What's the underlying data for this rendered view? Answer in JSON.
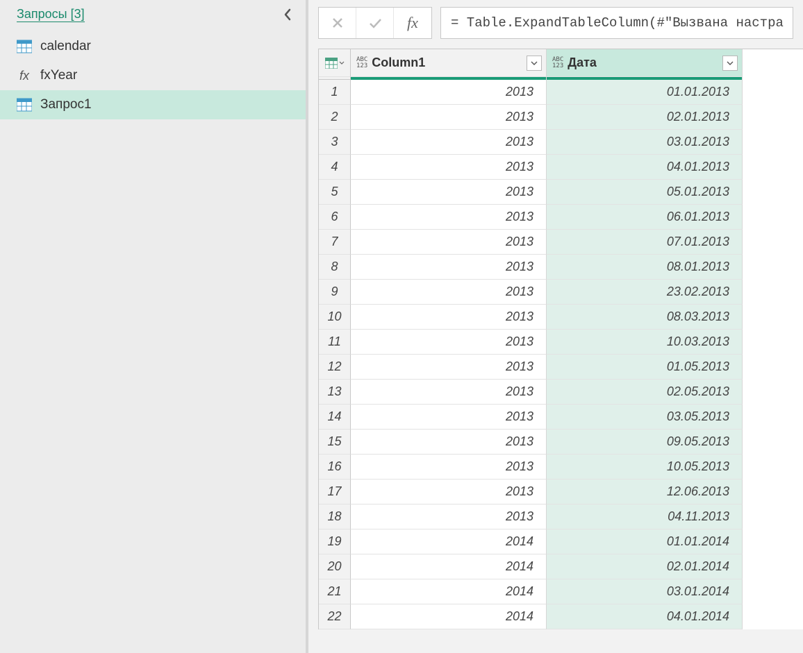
{
  "sidebar": {
    "title": "Запросы [3]",
    "items": [
      {
        "label": "calendar",
        "icon": "table",
        "selected": false
      },
      {
        "label": "fxYear",
        "icon": "fx",
        "selected": false
      },
      {
        "label": "Запрос1",
        "icon": "table",
        "selected": true
      }
    ]
  },
  "formula_bar": {
    "text": "= Table.ExpandTableColumn(#\"Вызвана настра"
  },
  "grid": {
    "columns": [
      {
        "name": "Column1",
        "type_label": "ABC 123",
        "selected": false
      },
      {
        "name": "Дата",
        "type_label": "ABC 123",
        "selected": true
      }
    ],
    "rows": [
      {
        "n": "1",
        "c1": "2013",
        "c2": "01.01.2013"
      },
      {
        "n": "2",
        "c1": "2013",
        "c2": "02.01.2013"
      },
      {
        "n": "3",
        "c1": "2013",
        "c2": "03.01.2013"
      },
      {
        "n": "4",
        "c1": "2013",
        "c2": "04.01.2013"
      },
      {
        "n": "5",
        "c1": "2013",
        "c2": "05.01.2013"
      },
      {
        "n": "6",
        "c1": "2013",
        "c2": "06.01.2013"
      },
      {
        "n": "7",
        "c1": "2013",
        "c2": "07.01.2013"
      },
      {
        "n": "8",
        "c1": "2013",
        "c2": "08.01.2013"
      },
      {
        "n": "9",
        "c1": "2013",
        "c2": "23.02.2013"
      },
      {
        "n": "10",
        "c1": "2013",
        "c2": "08.03.2013"
      },
      {
        "n": "11",
        "c1": "2013",
        "c2": "10.03.2013"
      },
      {
        "n": "12",
        "c1": "2013",
        "c2": "01.05.2013"
      },
      {
        "n": "13",
        "c1": "2013",
        "c2": "02.05.2013"
      },
      {
        "n": "14",
        "c1": "2013",
        "c2": "03.05.2013"
      },
      {
        "n": "15",
        "c1": "2013",
        "c2": "09.05.2013"
      },
      {
        "n": "16",
        "c1": "2013",
        "c2": "10.05.2013"
      },
      {
        "n": "17",
        "c1": "2013",
        "c2": "12.06.2013"
      },
      {
        "n": "18",
        "c1": "2013",
        "c2": "04.11.2013"
      },
      {
        "n": "19",
        "c1": "2014",
        "c2": "01.01.2014"
      },
      {
        "n": "20",
        "c1": "2014",
        "c2": "02.01.2014"
      },
      {
        "n": "21",
        "c1": "2014",
        "c2": "03.01.2014"
      },
      {
        "n": "22",
        "c1": "2014",
        "c2": "04.01.2014"
      }
    ]
  }
}
